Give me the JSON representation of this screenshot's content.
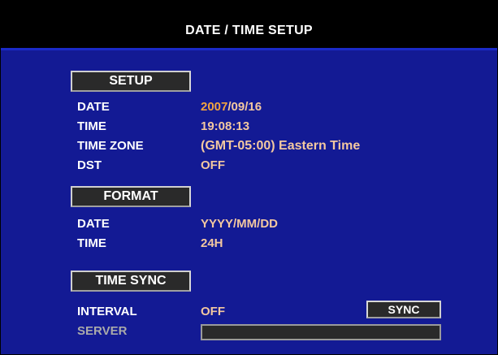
{
  "title": "DATE / TIME  SETUP",
  "setup": {
    "header": "SETUP",
    "date_label": "DATE",
    "date_year": "2007",
    "date_rest": "/09/16",
    "time_label": "TIME",
    "time_value": "19:08:13",
    "timezone_label": "TIME ZONE",
    "timezone_value": "(GMT-05:00) Eastern Time",
    "dst_label": "DST",
    "dst_value": "OFF"
  },
  "format": {
    "header": "FORMAT",
    "date_label": "DATE",
    "date_value": "YYYY/MM/DD",
    "time_label": "TIME",
    "time_value": "24H"
  },
  "timesync": {
    "header": "TIME SYNC",
    "interval_label": "INTERVAL",
    "interval_value": "OFF",
    "sync_label": "SYNC",
    "server_label": "SERVER",
    "server_value": ""
  },
  "colors": {
    "background": "#131a94",
    "titlebar": "#000000",
    "value_text": "#f3c8a0",
    "year_highlight": "#f2a340",
    "disabled_text": "#aaaaaa"
  }
}
